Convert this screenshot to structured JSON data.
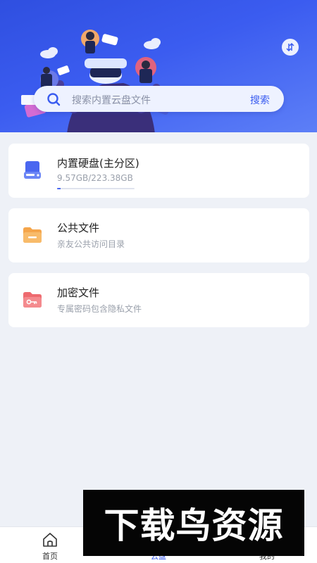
{
  "header": {
    "sort_icon": "sort-swap-icon"
  },
  "search": {
    "placeholder": "搜索内置云盘文件",
    "button_label": "搜索",
    "icon": "search-icon"
  },
  "cards": [
    {
      "title": "内置硬盘(主分区)",
      "subtitle": "9.57GB/223.38GB",
      "icon": "hard-drive-icon",
      "usage_fraction": 0.043
    },
    {
      "title": "公共文件",
      "subtitle": "亲友公共访问目录",
      "icon": "folder-icon"
    },
    {
      "title": "加密文件",
      "subtitle": "专属密码包含隐私文件",
      "icon": "key-folder-icon"
    }
  ],
  "tabbar": {
    "tabs": [
      {
        "label": "首页",
        "icon": "home-icon",
        "active": false
      },
      {
        "label": "云盘",
        "icon": "cloud-disk-icon",
        "active": true
      },
      {
        "label": "我的",
        "icon": "user-icon",
        "active": false
      }
    ]
  },
  "watermark": {
    "text": "下载鸟资源"
  },
  "colors": {
    "accent": "#3a5cf0",
    "hero_start": "#2f4fe0",
    "hero_end": "#5d7ff7",
    "background": "#eef1f7"
  }
}
